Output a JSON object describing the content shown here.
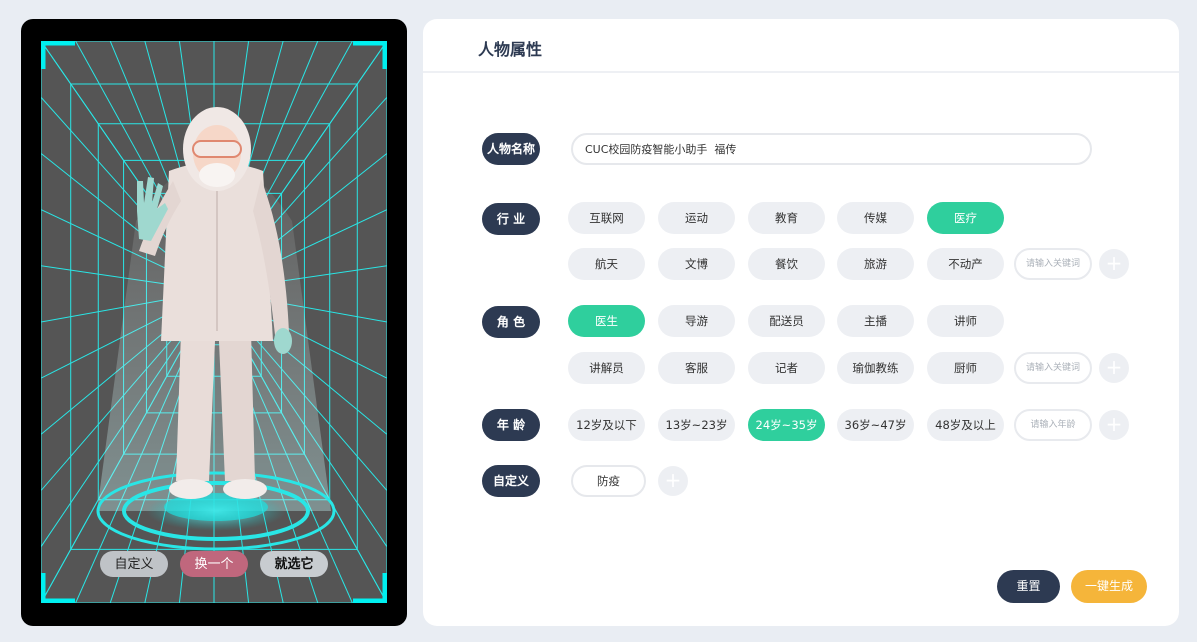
{
  "preview": {
    "buttons": {
      "custom": "自定义",
      "swap": "换一个",
      "choose": "就选它"
    },
    "grid_color": "#29e6e6"
  },
  "panel": {
    "title": "人物属性",
    "name": {
      "label": "人物名称",
      "value": "CUC校园防疫智能小助手  福传"
    },
    "industry": {
      "label": "行  业",
      "row1": [
        "互联网",
        "运动",
        "教育",
        "传媒",
        "医疗"
      ],
      "row2": [
        "航天",
        "文博",
        "餐饮",
        "旅游",
        "不动产"
      ],
      "selected": "医疗",
      "placeholder": "请输入关键词"
    },
    "role": {
      "label": "角  色",
      "row1": [
        "医生",
        "导游",
        "配送员",
        "主播",
        "讲师"
      ],
      "row2": [
        "讲解员",
        "客服",
        "记者",
        "瑜伽教练",
        "厨师"
      ],
      "selected": "医生",
      "placeholder": "请输入关键词"
    },
    "age": {
      "label": "年  龄",
      "options": [
        "12岁及以下",
        "13岁~23岁",
        "24岁~35岁",
        "36岁~47岁",
        "48岁及以上"
      ],
      "selected": "24岁~35岁",
      "placeholder": "请输入年龄"
    },
    "custom": {
      "label": "自定义",
      "tag": "防疫"
    },
    "plus_symbol": "+",
    "actions": {
      "reset": "重置",
      "generate": "一键生成"
    }
  },
  "colors": {
    "accent_green": "#2fcf9d",
    "navy": "#2d3a52",
    "orange": "#f5b53a",
    "pink": "#c0677d"
  }
}
